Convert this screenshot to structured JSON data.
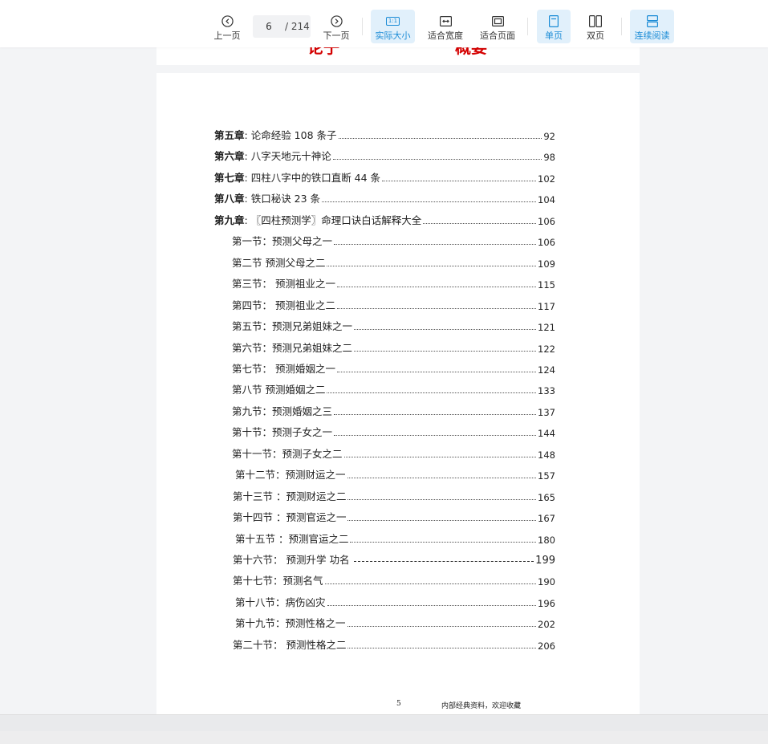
{
  "toolbar": {
    "prev_label": "上一页",
    "next_label": "下一页",
    "current_page": "6",
    "total_pages": "/ 214",
    "actual_size_label": "实际大小",
    "actual_size_icon_text": "1:1",
    "fit_width_label": "适合宽度",
    "fit_page_label": "适合页面",
    "single_page_label": "单页",
    "double_page_label": "双页",
    "continuous_label": "连续阅读",
    "accent": "#1a8bd6"
  },
  "prev_page_fragment": {
    "text_a": "论子",
    "text_b": "·",
    "text_c": "概要"
  },
  "toc": [
    {
      "prefix": "第五章",
      "title": ": 论命经验 108 条子",
      "page": "92"
    },
    {
      "prefix": "第六章",
      "title": ": 八字天地元十神论",
      "page": "98"
    },
    {
      "prefix": "第七章",
      "title": ": 四柱八字中的铁口直断 44 条",
      "page": "102"
    },
    {
      "prefix": "第八章",
      "title": ": 铁口秘诀 23 条",
      "page": "104"
    },
    {
      "prefix": "第九章",
      "title": ": 〖四柱预测学〗命理口诀白话解释大全",
      "page": "106"
    },
    {
      "prefix": "",
      "title": "第一节：预测父母之一",
      "page": "106"
    },
    {
      "prefix": "",
      "title": "第二节 预测父母之二",
      "page": "109"
    },
    {
      "prefix": "",
      "title": "第三节：  预测祖业之一",
      "page": "115"
    },
    {
      "prefix": "",
      "title": "第四节：  预测祖业之二",
      "page": "117"
    },
    {
      "prefix": "",
      "title": "第五节：预测兄弟姐妹之一",
      "page": "121"
    },
    {
      "prefix": "",
      "title": "第六节：预测兄弟姐妹之二",
      "page": "122"
    },
    {
      "prefix": "",
      "title": "第七节：  预测婚姻之一",
      "page": "124"
    },
    {
      "prefix": "",
      "title": "第八节 预测婚姻之二",
      "page": "133"
    },
    {
      "prefix": "",
      "title": "第九节：预测婚姻之三",
      "page": "137"
    },
    {
      "prefix": "",
      "title": "第十节：预测子女之一",
      "page": "144"
    },
    {
      "prefix": "",
      "title": "第十一节：预测子女之二",
      "page": "148"
    },
    {
      "prefix": "",
      "title": "第十二节：预测财运之一",
      "page": "157"
    },
    {
      "prefix": "",
      "title": "第十三节 ：预测财运之二",
      "page": "165"
    },
    {
      "prefix": "",
      "title": "第十四节 ：预测官运之一",
      "page": "167"
    },
    {
      "prefix": "",
      "title": "第十五节 ：预测官运之二",
      "page": "180"
    },
    {
      "prefix": "",
      "title": "第十六节：  预测升学   功名",
      "page": "199"
    },
    {
      "prefix": "",
      "title": "第十七节：预测名气",
      "page": "190"
    },
    {
      "prefix": "",
      "title": "第十八节：病伤凶灾",
      "page": "196"
    },
    {
      "prefix": "",
      "title": "第十九节：预测性格之一",
      "page": "202"
    },
    {
      "prefix": "",
      "title": "第二十节：  预测性格之二",
      "page": "206"
    }
  ],
  "footer": {
    "page_number": "5",
    "note": "内部经典资料，欢迎收藏"
  }
}
